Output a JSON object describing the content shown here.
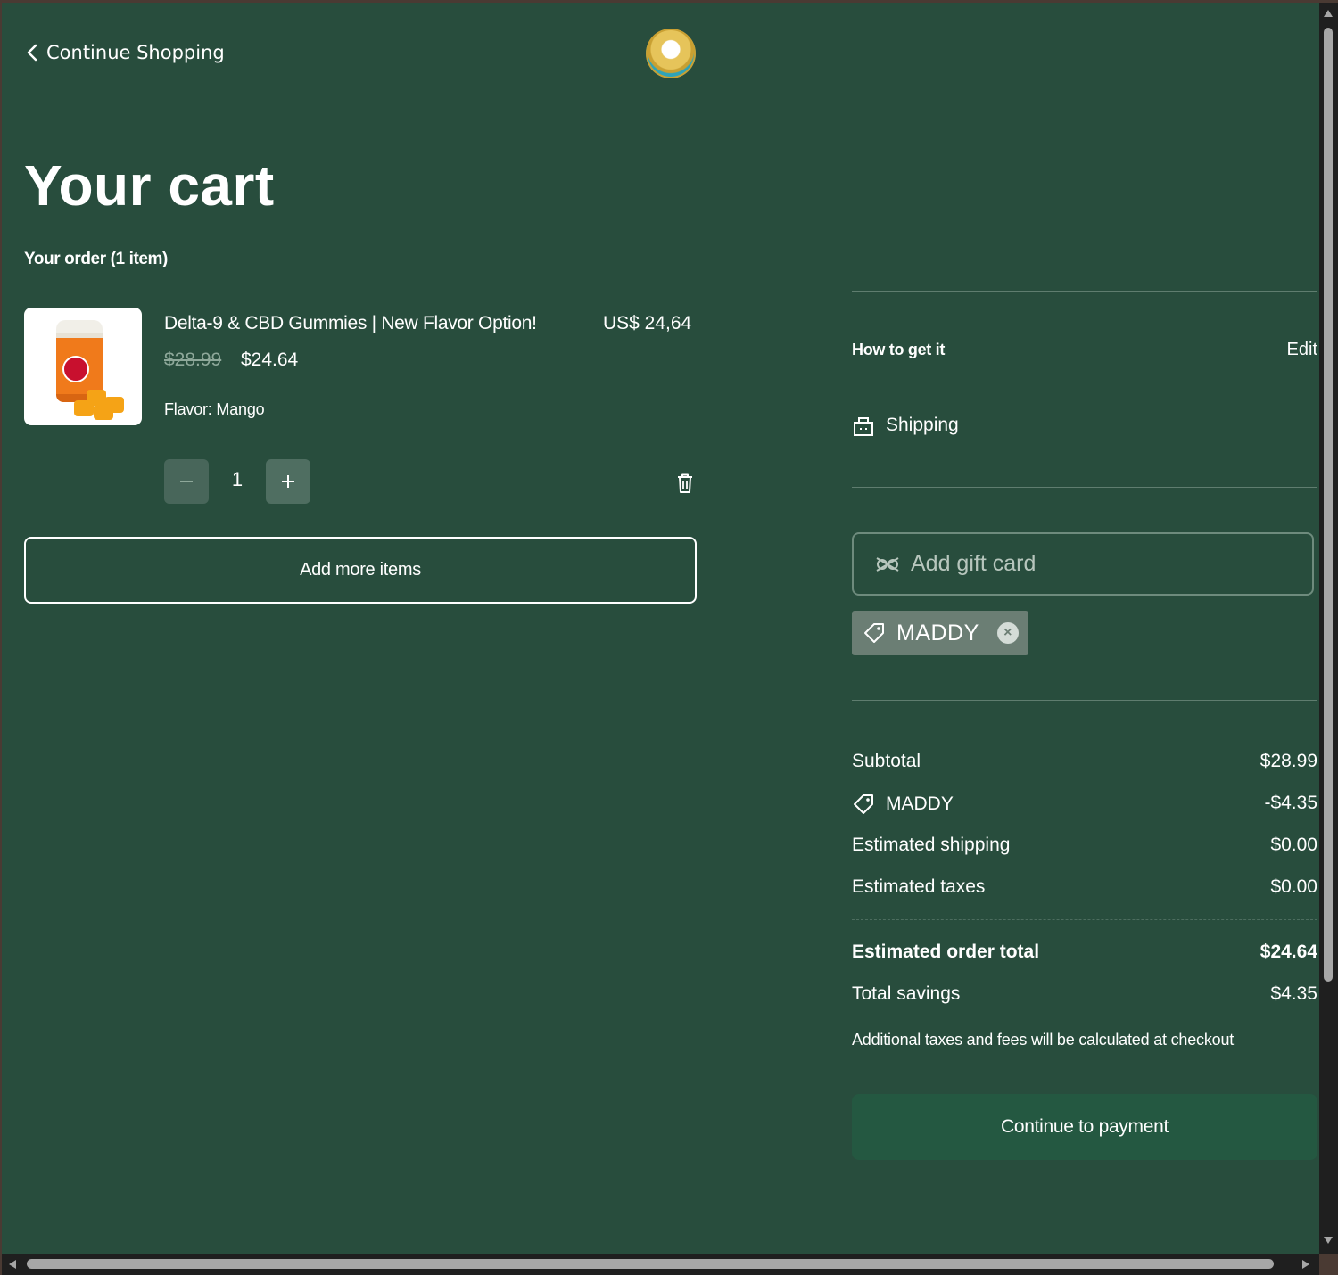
{
  "header": {
    "continue_label": "Continue Shopping",
    "logo_icon": "brand-logo-icon"
  },
  "cart": {
    "title": "Your cart",
    "order_count": "Your order (1 item)"
  },
  "item": {
    "name": "Delta-9 & CBD Gummies | New Flavor Option!",
    "line_total": "US$ 24,64",
    "original_price": "$28.99",
    "sale_price": "$24.64",
    "variant": "Flavor: Mango",
    "quantity": "1",
    "decrease_icon": "minus-icon",
    "increase_icon": "plus-icon",
    "remove_icon": "trash-icon"
  },
  "add_more_label": "Add more items",
  "fulfillment": {
    "label": "How to get it",
    "edit_label": "Edit",
    "method": "Shipping",
    "method_icon": "shop-bag-icon"
  },
  "gift_card": {
    "placeholder": "Add gift card",
    "icon": "gift-card-icon"
  },
  "coupon": {
    "code": "MADDY",
    "icon": "tag-icon",
    "remove_icon": "close-circle-icon"
  },
  "summary": {
    "subtotal_label": "Subtotal",
    "subtotal_value": "$28.99",
    "discount_label": "MADDY",
    "discount_value": "-$4.35",
    "shipping_label": "Estimated shipping",
    "shipping_value": "$0.00",
    "taxes_label": "Estimated taxes",
    "taxes_value": "$0.00",
    "total_label": "Estimated order total",
    "total_value": "$24.64",
    "savings_label": "Total savings",
    "savings_value": "$4.35",
    "note": "Additional taxes and fees will be calculated at checkout"
  },
  "pay_button_label": "Continue to payment",
  "colors": {
    "background": "#284d3d",
    "primary_button": "#245841",
    "chip": "#6b7e74"
  }
}
